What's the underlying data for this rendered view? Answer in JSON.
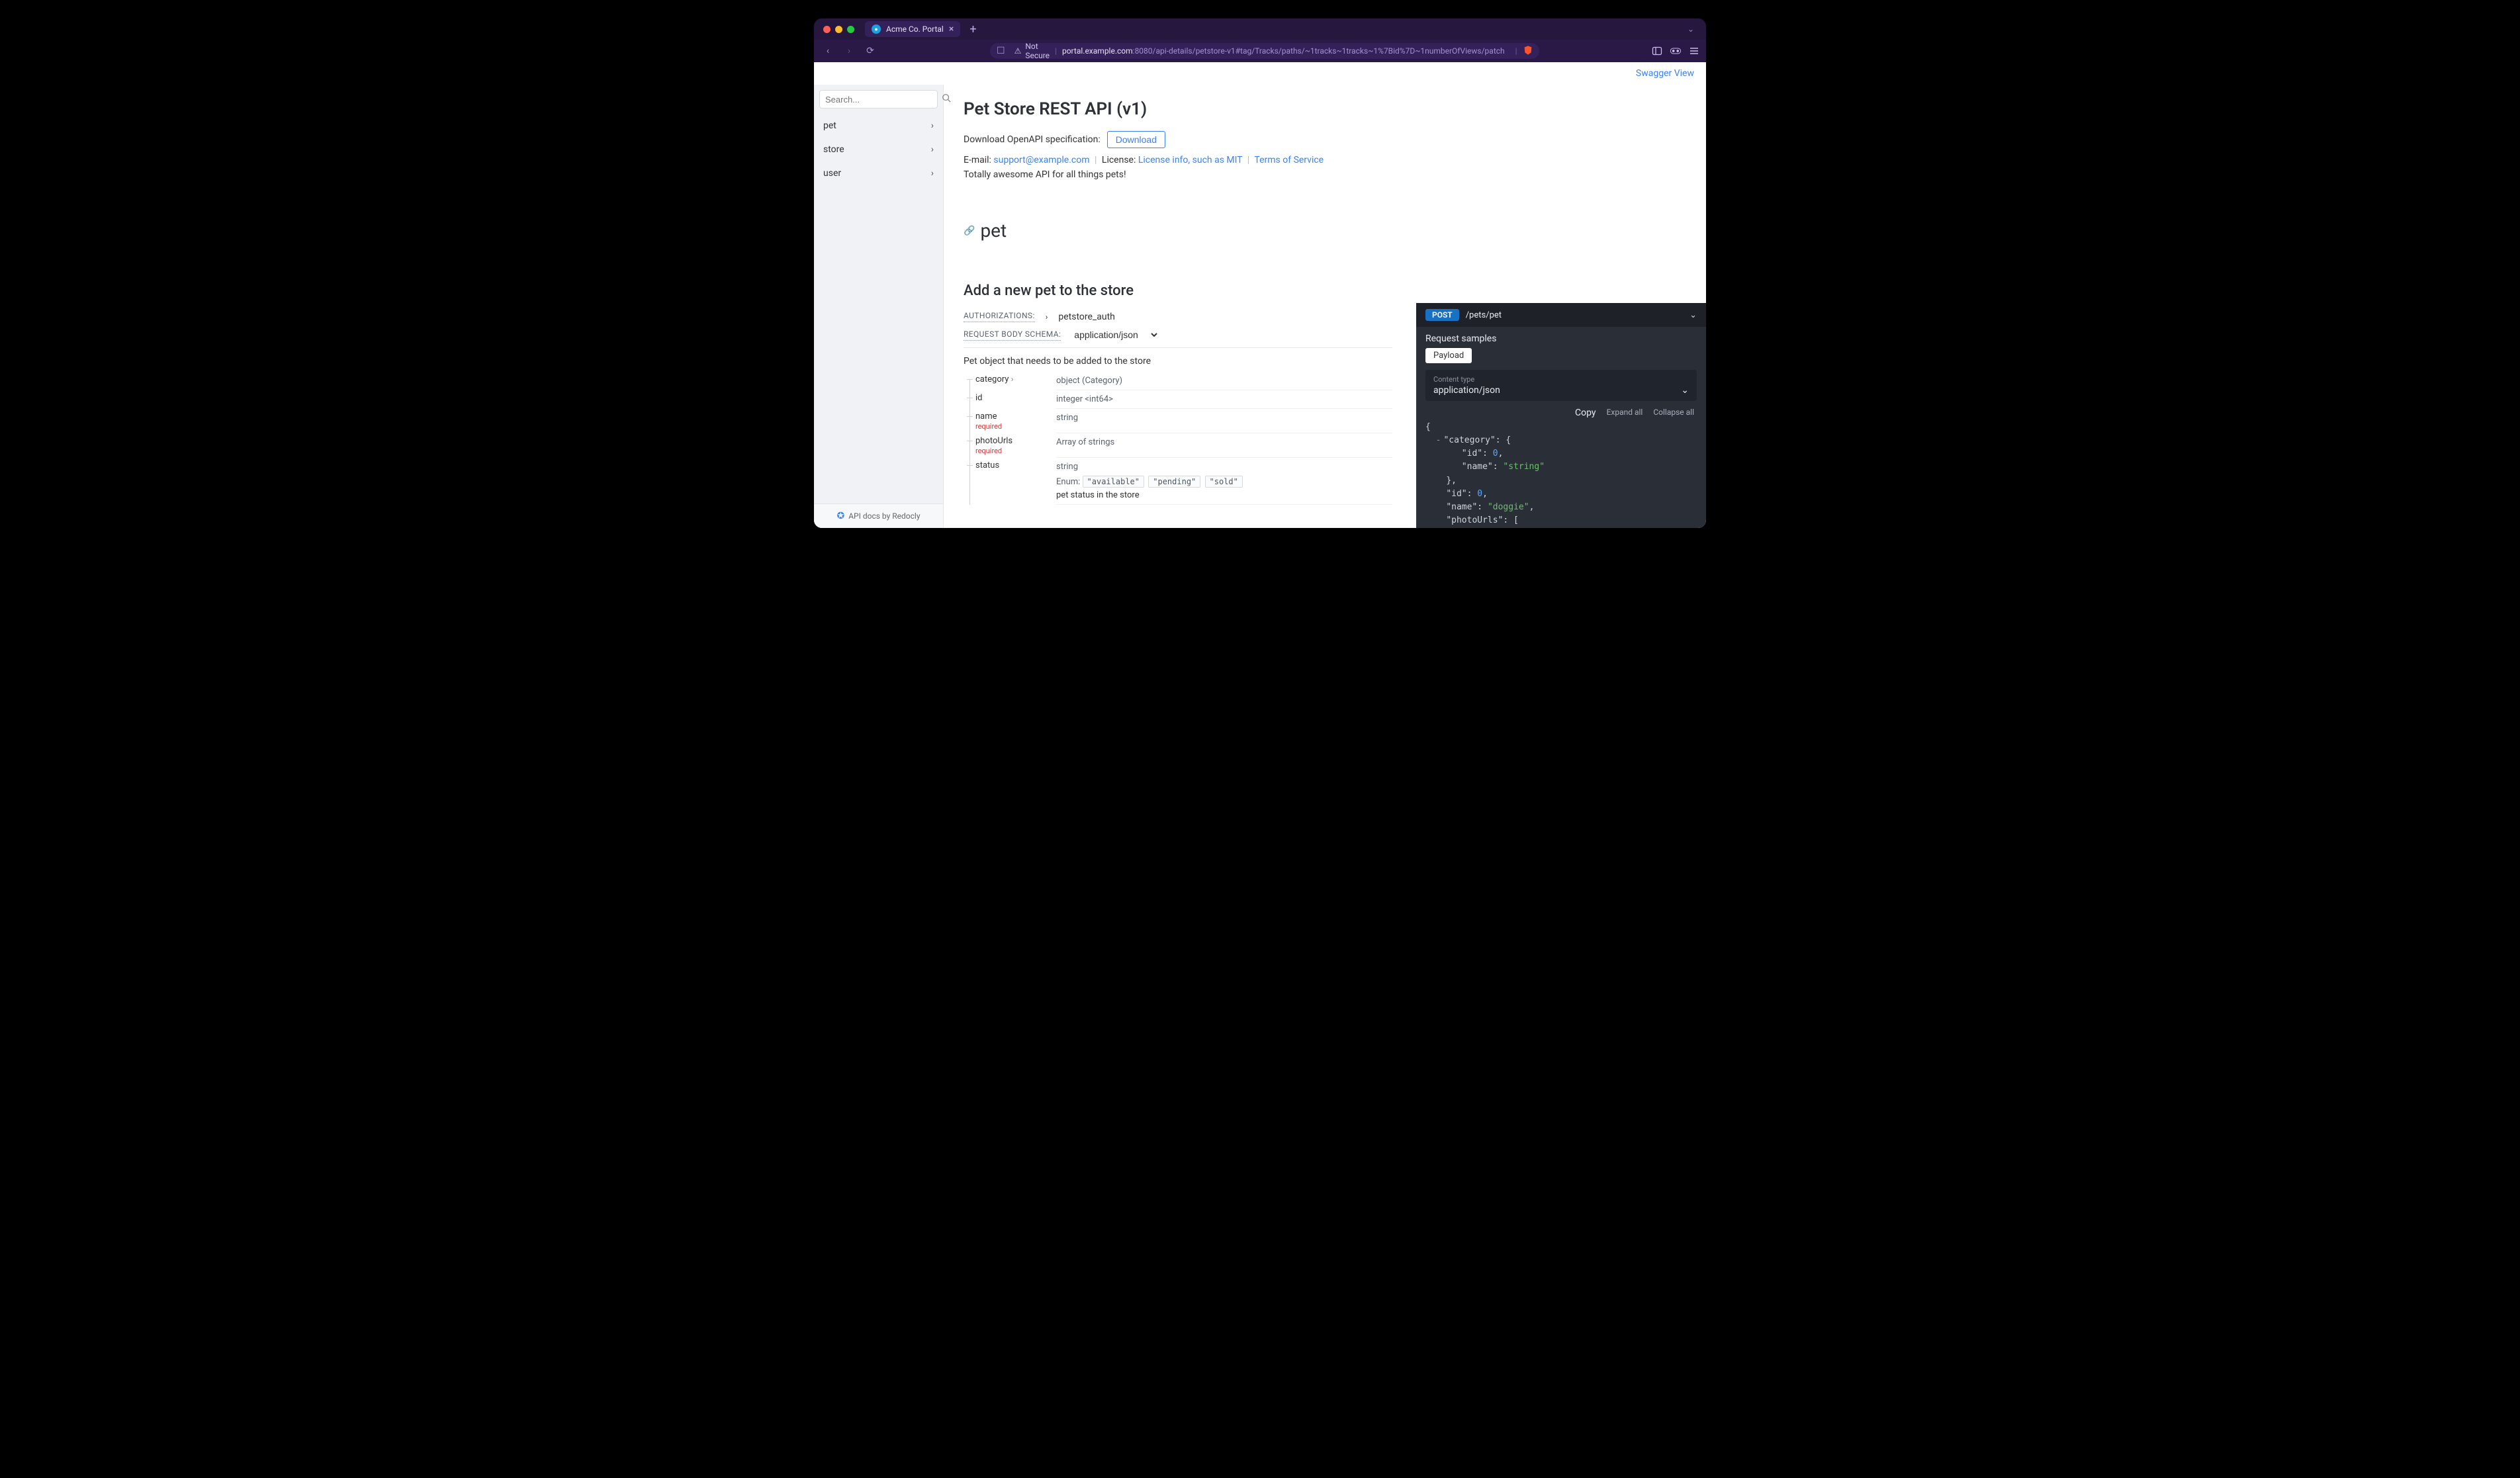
{
  "browser": {
    "tab_title": "Acme Co. Portal",
    "not_secure": "Not Secure",
    "host": "portal.example.com",
    "port": ":8080",
    "path": "/api-details/petstore-v1#tag/Tracks/paths/~1tracks~1tracks~1%7Bid%7D~1numberOfViews/patch"
  },
  "topbar": {
    "swagger_view": "Swagger View"
  },
  "sidebar": {
    "search_placeholder": "Search...",
    "items": [
      {
        "label": "pet"
      },
      {
        "label": "store"
      },
      {
        "label": "user"
      }
    ],
    "footer": "API docs by Redocly"
  },
  "doc": {
    "title": "Pet Store REST API (v1)",
    "spec_label": "Download OpenAPI specification:",
    "download_btn": "Download",
    "email_label": "E-mail: ",
    "email": "support@example.com",
    "license_label": "License: ",
    "license": "License info, such as MIT",
    "tos": "Terms of Service",
    "description": "Totally awesome API for all things pets!",
    "section": "pet",
    "operation_title": "Add a new pet to the store",
    "authorizations_label": "AUTHORIZATIONS:",
    "auth_scheme": "petstore_auth",
    "request_body_label": "REQUEST BODY SCHEMA:",
    "content_type": "application/json",
    "body_desc": "Pet object that needs to be added to the store",
    "fields": {
      "category": {
        "name": "category",
        "type": "object (Category)"
      },
      "id": {
        "name": "id",
        "type": "integer <int64>"
      },
      "name": {
        "name": "name",
        "type": "string",
        "required": "required"
      },
      "photoUrls": {
        "name": "photoUrls",
        "type": "Array of strings",
        "required": "required"
      },
      "status": {
        "name": "status",
        "type": "string",
        "enum_label": "Enum:",
        "enum": [
          "\"available\"",
          "\"pending\"",
          "\"sold\""
        ],
        "desc": "pet status in the store"
      }
    }
  },
  "samples": {
    "method": "POST",
    "path": "/pets/pet",
    "request_samples_label": "Request samples",
    "payload_tab": "Payload",
    "content_type_label": "Content type",
    "content_type": "application/json",
    "copy": "Copy",
    "expand_all": "Expand all",
    "collapse_all": "Collapse all",
    "json": {
      "l1": "{",
      "l2a": "\"category\"",
      "l2b": ": {",
      "l3a": "\"id\"",
      "l3b": ": ",
      "l3c": "0",
      "l3d": ",",
      "l4a": "\"name\"",
      "l4b": ": ",
      "l4c": "\"string\"",
      "l5": "},",
      "l6a": "\"id\"",
      "l6b": ": ",
      "l6c": "0",
      "l6d": ",",
      "l7a": "\"name\"",
      "l7b": ": ",
      "l7c": "\"doggie\"",
      "l7d": ",",
      "l8a": "\"photoUrls\"",
      "l8b": ": ["
    }
  }
}
